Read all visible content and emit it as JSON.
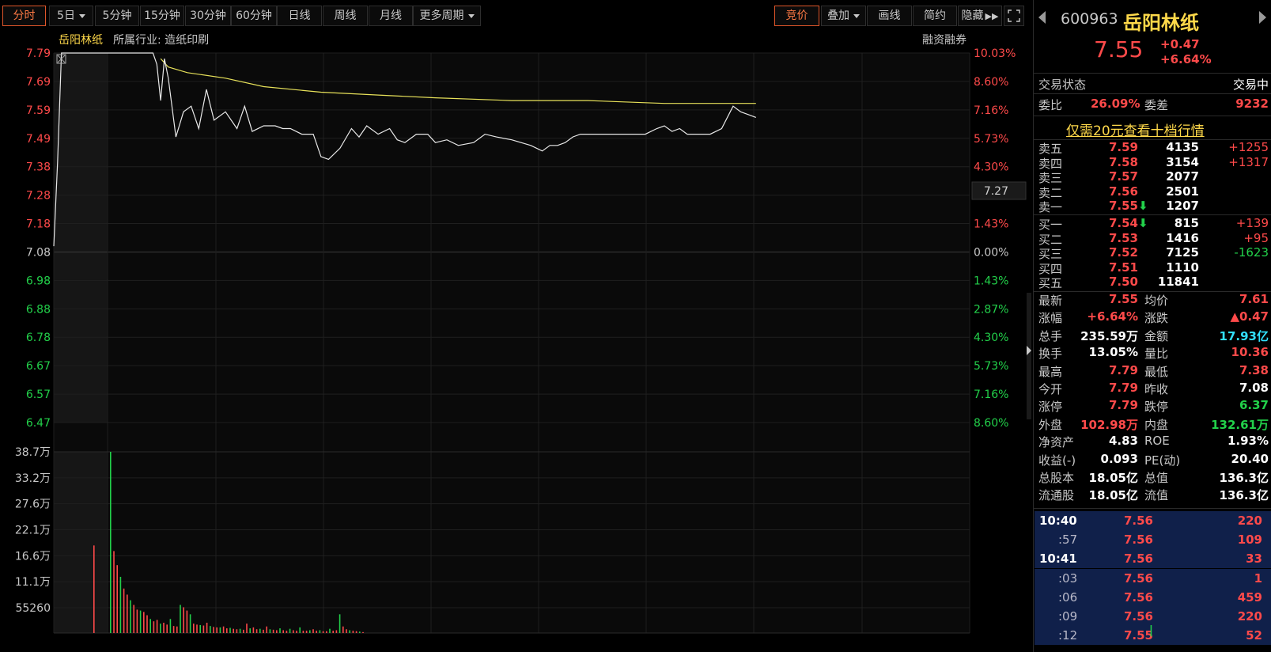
{
  "toolbar": {
    "left": [
      "分时",
      "5日",
      "5分钟",
      "15分钟",
      "30分钟",
      "60分钟",
      "日线",
      "周线",
      "月线",
      "更多周期"
    ],
    "right": [
      "竞价",
      "叠加",
      "画线",
      "简约",
      "隐藏"
    ]
  },
  "header": {
    "name": "岳阳林纸",
    "industry": "所属行业: 造纸印刷",
    "margin": "融资融券",
    "current_price_tag": "7.27"
  },
  "axes": {
    "price_ticks": [
      "7.79",
      "7.69",
      "7.59",
      "7.49",
      "7.38",
      "7.28",
      "7.18",
      "7.08",
      "6.98",
      "6.88",
      "6.78",
      "6.67",
      "6.57",
      "6.47"
    ],
    "pct_ticks": [
      "10.03%",
      "8.60%",
      "7.16%",
      "5.73%",
      "4.30%",
      "2.87%",
      "1.43%",
      "0.00%",
      "1.43%",
      "2.87%",
      "4.30%",
      "5.73%",
      "7.16%",
      "8.60%"
    ],
    "volume_ticks": [
      "38.7万",
      "33.2万",
      "27.6万",
      "22.1万",
      "16.6万",
      "11.1万",
      "55260"
    ]
  },
  "chart_data": {
    "type": "line",
    "prev_close": 7.08,
    "ylim": [
      6.47,
      7.79
    ],
    "x_minutes_range": [
      0,
      240
    ],
    "series": [
      {
        "values_x": [
          0,
          1,
          2,
          3,
          5,
          10,
          20,
          25,
          26,
          27,
          28,
          29,
          30,
          32,
          34,
          36,
          38,
          40,
          42,
          45,
          48,
          50,
          52,
          55,
          58,
          60,
          62,
          65,
          68,
          70,
          72,
          75,
          78,
          80,
          82,
          85,
          88,
          90,
          92,
          95,
          98,
          100,
          103,
          106,
          110,
          113,
          116,
          120,
          125,
          128,
          130,
          132,
          134,
          136,
          138,
          140,
          145,
          150,
          155,
          158,
          160,
          162,
          164,
          166,
          168,
          170,
          172,
          175,
          178,
          180,
          182,
          184
        ],
        "values_y": [
          7.1,
          7.4,
          7.79,
          7.79,
          7.79,
          7.79,
          7.79,
          7.79,
          7.79,
          7.75,
          7.62,
          7.77,
          7.7,
          7.49,
          7.58,
          7.6,
          7.52,
          7.66,
          7.55,
          7.58,
          7.52,
          7.6,
          7.51,
          7.53,
          7.53,
          7.52,
          7.52,
          7.5,
          7.5,
          7.42,
          7.41,
          7.45,
          7.52,
          7.49,
          7.53,
          7.5,
          7.52,
          7.48,
          7.47,
          7.5,
          7.5,
          7.47,
          7.48,
          7.46,
          7.47,
          7.5,
          7.49,
          7.48,
          7.46,
          7.44,
          7.46,
          7.46,
          7.47,
          7.49,
          7.5,
          7.5,
          7.5,
          7.5,
          7.5,
          7.52,
          7.53,
          7.51,
          7.52,
          7.5,
          7.5,
          7.5,
          7.5,
          7.52,
          7.6,
          7.58,
          7.57,
          7.56
        ]
      },
      {
        "values_x": [
          28,
          30,
          35,
          45,
          55,
          70,
          85,
          100,
          120,
          140,
          160,
          184
        ],
        "values_y": [
          7.77,
          7.74,
          7.72,
          7.7,
          7.67,
          7.65,
          7.64,
          7.63,
          7.62,
          7.62,
          7.61,
          7.61
        ]
      }
    ],
    "volume": [
      187000,
      387000,
      175000,
      145000,
      120000,
      95000,
      82000,
      70000,
      60000,
      50000,
      48000,
      45000,
      38000,
      30000,
      25000,
      28000,
      20000,
      22000,
      18000,
      30000,
      15000,
      14000,
      60000,
      55000,
      48000,
      40000,
      20000,
      18000,
      17000,
      16000,
      22000,
      15000,
      13000,
      12000,
      12000,
      14000,
      10000,
      11000,
      9000,
      8000,
      9000,
      7000,
      20000,
      10000,
      12000,
      8000,
      9000,
      7000,
      14000,
      8000,
      7000,
      6000,
      10000,
      6000,
      5000,
      9000,
      6000,
      5000,
      12000,
      5000,
      5000,
      6000,
      8000,
      5000,
      6000,
      4000,
      4000,
      9000,
      5000,
      6000,
      40000,
      14000,
      8000,
      6000,
      5000,
      4000,
      3000,
      2000
    ]
  },
  "panel": {
    "code": "600963",
    "name": "岳阳林纸",
    "price": "7.55",
    "change": "+0.47",
    "change_pct": "+6.64%",
    "status_label": "交易状态",
    "status": "交易中",
    "wb_label": "委比",
    "wb": "26.09%",
    "wc_label": "委差",
    "wc": "9232",
    "promo": "仅需20元查看十档行情",
    "asks": [
      {
        "label": "卖五",
        "price": "7.59",
        "vol": "4135",
        "chg": "+1255"
      },
      {
        "label": "卖四",
        "price": "7.58",
        "vol": "3154",
        "chg": "+1317"
      },
      {
        "label": "卖三",
        "price": "7.57",
        "vol": "2077",
        "chg": ""
      },
      {
        "label": "卖二",
        "price": "7.56",
        "vol": "2501",
        "chg": ""
      },
      {
        "label": "卖一",
        "price": "7.55",
        "vol": "1207",
        "chg": ""
      }
    ],
    "bids": [
      {
        "label": "买一",
        "price": "7.54",
        "vol": "815",
        "chg": "+139"
      },
      {
        "label": "买二",
        "price": "7.53",
        "vol": "1416",
        "chg": "+95"
      },
      {
        "label": "买三",
        "price": "7.52",
        "vol": "7125",
        "chg": "-1623"
      },
      {
        "label": "买四",
        "price": "7.51",
        "vol": "1110",
        "chg": ""
      },
      {
        "label": "买五",
        "price": "7.50",
        "vol": "11841",
        "chg": ""
      }
    ],
    "stats": [
      [
        "最新",
        "7.55",
        "均价",
        "7.61"
      ],
      [
        "涨幅",
        "+6.64%",
        "涨跌",
        "▲0.47"
      ],
      [
        "总手",
        "235.59万",
        "金额",
        "17.93亿"
      ],
      [
        "换手",
        "13.05%",
        "量比",
        "10.36"
      ],
      [
        "最高",
        "7.79",
        "最低",
        "7.38"
      ],
      [
        "今开",
        "7.79",
        "昨收",
        "7.08"
      ],
      [
        "涨停",
        "7.79",
        "跌停",
        "6.37"
      ],
      [
        "外盘",
        "102.98万",
        "内盘",
        "132.61万"
      ],
      [
        "净资产",
        "4.83",
        "ROE",
        "1.93%"
      ],
      [
        "收益(-)",
        "0.093",
        "PE(动)",
        "20.40"
      ],
      [
        "总股本",
        "18.05亿",
        "总值",
        "136.3亿"
      ],
      [
        "流通股",
        "18.05亿",
        "流值",
        "136.3亿"
      ]
    ],
    "ticks": [
      {
        "time": "10:40",
        "price": "7.56",
        "vol": "220"
      },
      {
        "time": ":57",
        "price": "7.56",
        "vol": "109"
      },
      {
        "time": "10:41",
        "price": "7.56",
        "vol": "33"
      },
      {
        "time": ":03",
        "price": "7.56",
        "vol": "1"
      },
      {
        "time": ":06",
        "price": "7.56",
        "vol": "459"
      },
      {
        "time": ":09",
        "price": "7.56",
        "vol": "220"
      },
      {
        "time": ":12",
        "price": "7.55",
        "vol": "52"
      }
    ]
  }
}
